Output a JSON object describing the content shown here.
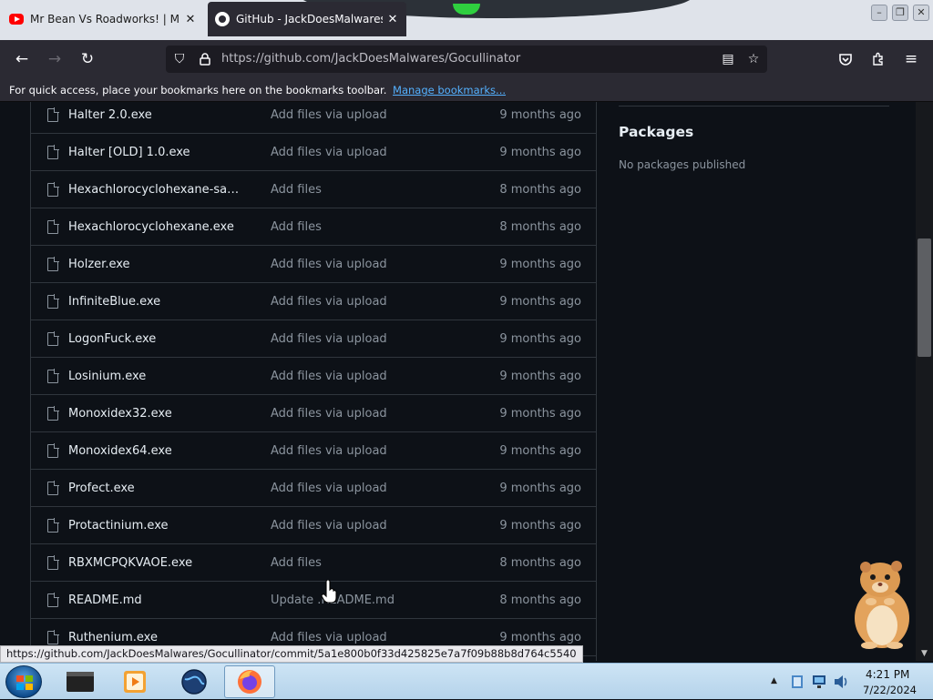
{
  "browser": {
    "tabs": [
      {
        "title": "Mr Bean Vs Roadworks! | Mr Bean",
        "favicon": "youtube-icon",
        "active": false
      },
      {
        "title": "GitHub - JackDoesMalwares/Gocullinator",
        "favicon": "github-icon",
        "active": true
      }
    ],
    "url": "https://github.com/JackDoesMalwares/Gocullinator",
    "bookmarks_bar": {
      "text": "For quick access, place your bookmarks here on the bookmarks toolbar.",
      "link": "Manage bookmarks..."
    },
    "status_url": "https://github.com/JackDoesMalwares/Gocullinator/commit/5a1e800b0f33d425825e7a7f09b88b8d764c5540"
  },
  "files": [
    {
      "name": "Halter 2.0.exe",
      "message": "Add files via upload",
      "age": "9 months ago"
    },
    {
      "name": "Halter [OLD] 1.0.exe",
      "message": "Add files via upload",
      "age": "9 months ago"
    },
    {
      "name": "Hexachlorocyclohexane-safet...",
      "message": "Add files",
      "age": "8 months ago"
    },
    {
      "name": "Hexachlorocyclohexane.exe",
      "message": "Add files",
      "age": "8 months ago"
    },
    {
      "name": "Holzer.exe",
      "message": "Add files via upload",
      "age": "9 months ago"
    },
    {
      "name": "InfiniteBlue.exe",
      "message": "Add files via upload",
      "age": "9 months ago"
    },
    {
      "name": "LogonFuck.exe",
      "message": "Add files via upload",
      "age": "9 months ago"
    },
    {
      "name": "Losinium.exe",
      "message": "Add files via upload",
      "age": "9 months ago"
    },
    {
      "name": "Monoxidex32.exe",
      "message": "Add files via upload",
      "age": "9 months ago"
    },
    {
      "name": "Monoxidex64.exe",
      "message": "Add files via upload",
      "age": "9 months ago"
    },
    {
      "name": "Profect.exe",
      "message": "Add files via upload",
      "age": "9 months ago"
    },
    {
      "name": "Protactinium.exe",
      "message": "Add files via upload",
      "age": "9 months ago"
    },
    {
      "name": "RBXMCPQKVAOE.exe",
      "message": "Add files",
      "age": "8 months ago"
    },
    {
      "name": "README.md",
      "message": "Update .README.md",
      "age": "8 months ago"
    },
    {
      "name": "Ruthenium.exe",
      "message": "Add files via upload",
      "age": "9 months ago"
    }
  ],
  "sidebar": {
    "packages_title": "Packages",
    "packages_empty": "No packages published"
  },
  "taskbar": {
    "time": "4:21 PM",
    "date": "7/22/2024",
    "pinned": [
      "terminal-icon",
      "media-player-icon",
      "globe-icon",
      "firefox-icon"
    ]
  },
  "colors": {
    "page_bg": "#0d1117",
    "border": "#30363d",
    "text_primary": "#e6edf3",
    "text_muted": "#8b949e",
    "link": "#54b1ff",
    "firefox_chrome": "#2b2a33"
  }
}
